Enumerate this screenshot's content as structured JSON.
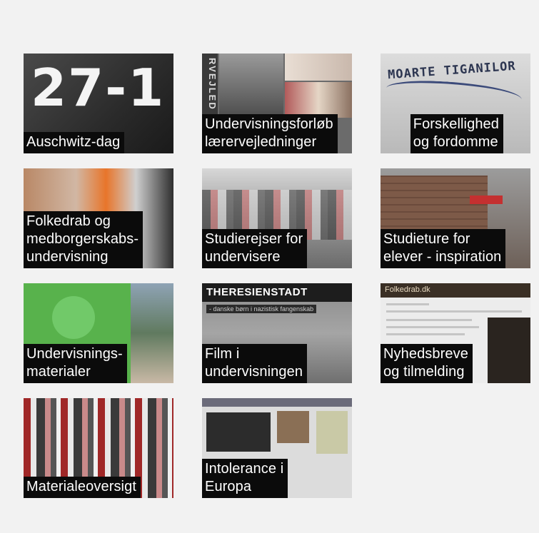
{
  "tiles": [
    {
      "title": "Auschwitz-dag",
      "big_text": "27-1"
    },
    {
      "title": "Undervisningsforløb\nlærervejledninger",
      "strip_text": "RVEJLED"
    },
    {
      "title": "Forskellighed\nog fordomme",
      "graffiti_text": "MOARTE TIGANILOR"
    },
    {
      "title": "Folkedrab og\nmedborgerskabs-\nundervisning"
    },
    {
      "title": "Studierejser for\nundervisere"
    },
    {
      "title": "Studieture for\nelever - inspiration"
    },
    {
      "title": "Undervisnings-\nmaterialer"
    },
    {
      "title": "Film i\nundervisningen",
      "header_text": "THERESIENSTADT",
      "sub_text": "- danske børn i nazistisk fangenskab"
    },
    {
      "title": "Nyhedsbreve\nog tilmelding",
      "site_text": "Folkedrab.dk"
    },
    {
      "title": "Materialeoversigt"
    },
    {
      "title": "Intolerance i\nEuropa"
    }
  ]
}
